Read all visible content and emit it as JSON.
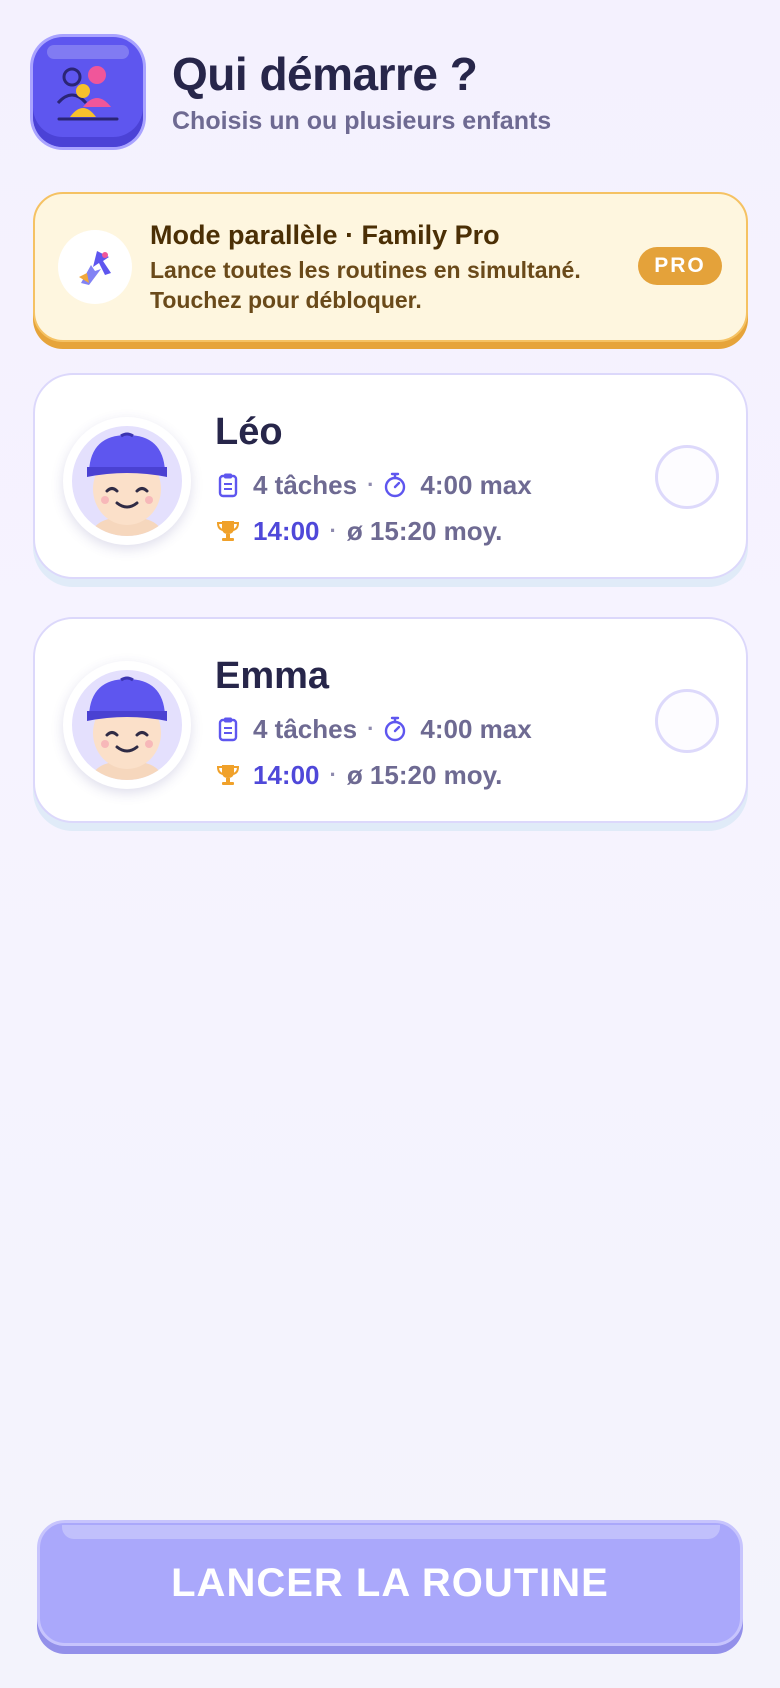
{
  "header": {
    "title": "Qui démarre ?",
    "subtitle": "Choisis un ou plusieurs enfants",
    "icon": "children-group-icon"
  },
  "promo": {
    "title": "Mode parallèle · Family Pro",
    "line1": "Lance toutes les routines en simultané.",
    "line2": "Touchez pour débloquer.",
    "badge": "PRO",
    "icon": "parallel-arrows-icon"
  },
  "children": [
    {
      "name": "Léo",
      "tasks": "4 tâches",
      "max_time": "4:00 max",
      "best_time": "14:00",
      "avg_time": "ø 15:20 moy.",
      "selected": false
    },
    {
      "name": "Emma",
      "tasks": "4 tâches",
      "max_time": "4:00 max",
      "best_time": "14:00",
      "avg_time": "ø 15:20 moy.",
      "selected": false
    }
  ],
  "launch_button": {
    "label": "LANCER LA ROUTINE",
    "enabled": false
  },
  "colors": {
    "accent": "#5e56ef",
    "text_dark": "#27264a",
    "text_muted": "#6e6a92",
    "promo_bg": "#fef6df",
    "pro_badge": "#e4a23a",
    "best_time": "#4f48d9",
    "button_disabled": "#aaa8fb"
  },
  "separator": "·"
}
